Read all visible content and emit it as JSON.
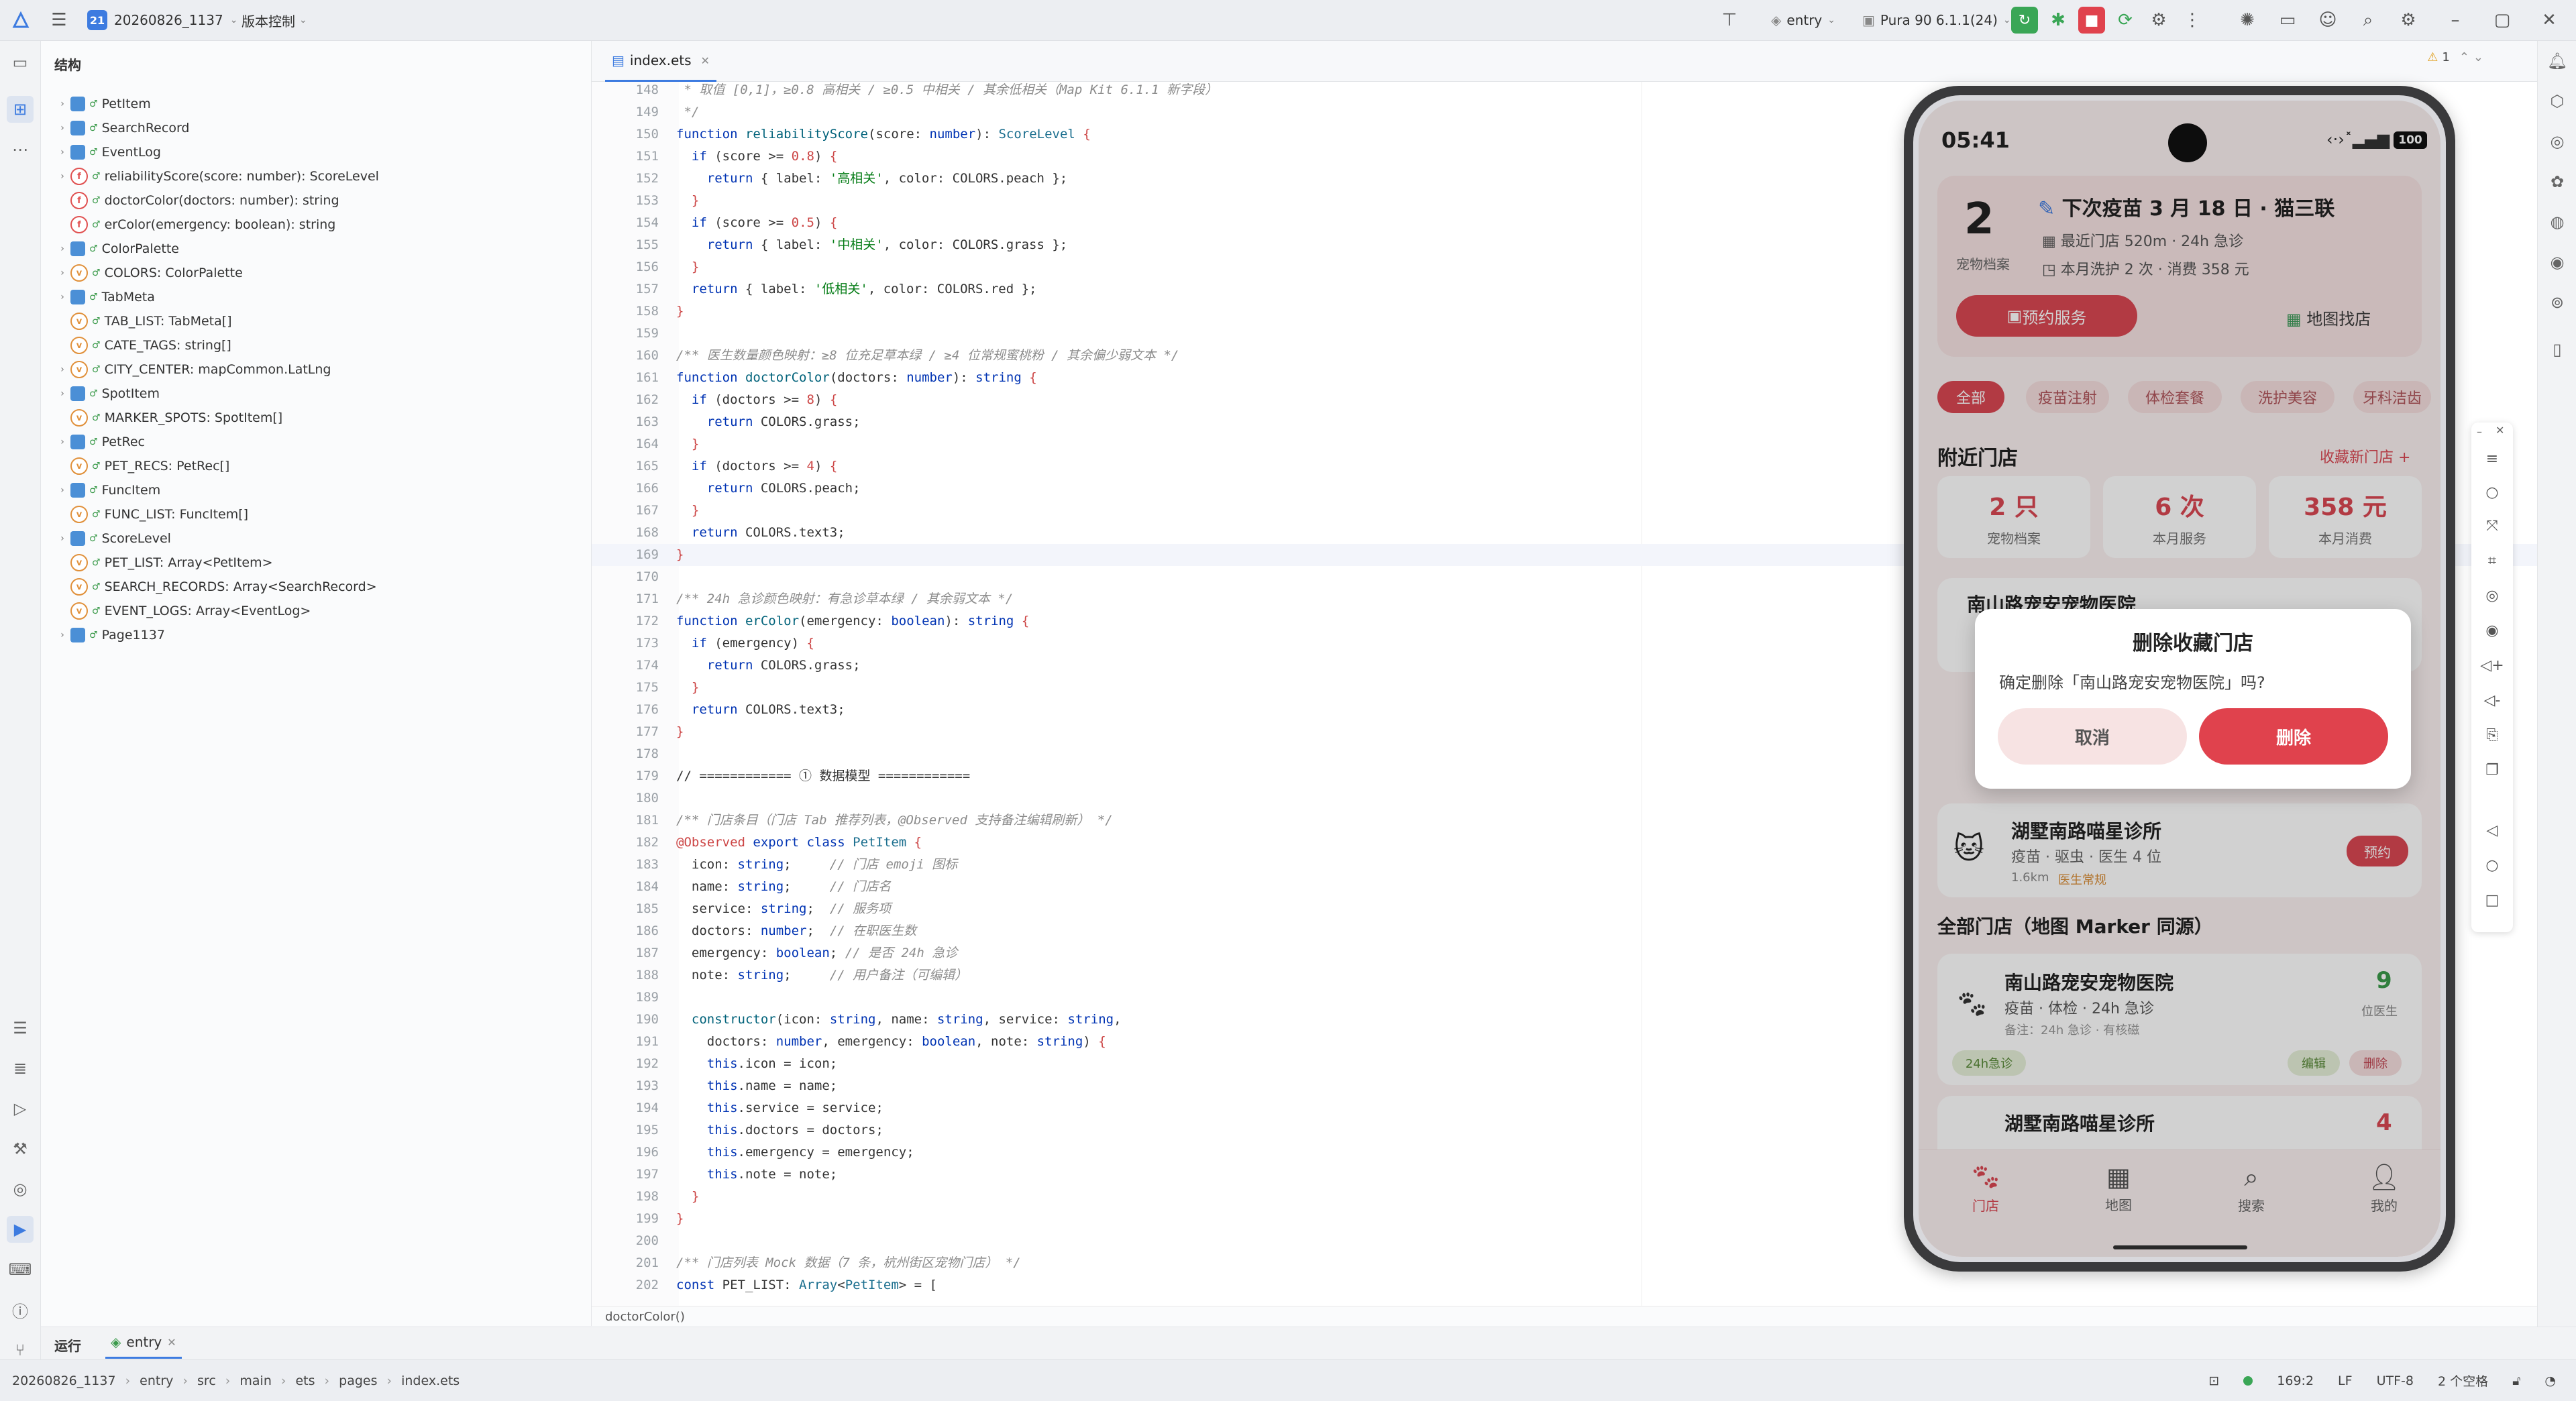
{
  "titlebar": {
    "project_number": "21",
    "project_name": "20260826_1137",
    "vcs_label": "版本控制",
    "run_config": "entry",
    "device": "Pura 90 6.1.1(24)"
  },
  "structure": {
    "title": "结构",
    "items": [
      {
        "label": "PetItem",
        "kind": "c",
        "expand": true
      },
      {
        "label": "SearchRecord",
        "kind": "c",
        "expand": true
      },
      {
        "label": "EventLog",
        "kind": "c",
        "expand": true
      },
      {
        "label": "reliabilityScore(score: number): ScoreLevel",
        "kind": "f",
        "expand": true
      },
      {
        "label": "doctorColor(doctors: number): string",
        "kind": "f",
        "expand": false
      },
      {
        "label": "erColor(emergency: boolean): string",
        "kind": "f",
        "expand": false
      },
      {
        "label": "ColorPalette",
        "kind": "c",
        "expand": true
      },
      {
        "label": "COLORS: ColorPalette",
        "kind": "v",
        "expand": true
      },
      {
        "label": "TabMeta",
        "kind": "c",
        "expand": true
      },
      {
        "label": "TAB_LIST: TabMeta[]",
        "kind": "v",
        "expand": false
      },
      {
        "label": "CATE_TAGS: string[]",
        "kind": "v",
        "expand": false
      },
      {
        "label": "CITY_CENTER: mapCommon.LatLng",
        "kind": "v",
        "expand": true
      },
      {
        "label": "SpotItem",
        "kind": "c",
        "expand": true
      },
      {
        "label": "MARKER_SPOTS: SpotItem[]",
        "kind": "v",
        "expand": false
      },
      {
        "label": "PetRec",
        "kind": "c",
        "expand": true
      },
      {
        "label": "PET_RECS: PetRec[]",
        "kind": "v",
        "expand": false
      },
      {
        "label": "FuncItem",
        "kind": "c",
        "expand": true
      },
      {
        "label": "FUNC_LIST: FuncItem[]",
        "kind": "v",
        "expand": false
      },
      {
        "label": "ScoreLevel",
        "kind": "c",
        "expand": true
      },
      {
        "label": "PET_LIST: Array<PetItem>",
        "kind": "v",
        "expand": false
      },
      {
        "label": "SEARCH_RECORDS: Array<SearchRecord>",
        "kind": "v",
        "expand": false
      },
      {
        "label": "EVENT_LOGS: Array<EventLog>",
        "kind": "v",
        "expand": false
      },
      {
        "label": "Page1137",
        "kind": "c",
        "expand": true
      }
    ]
  },
  "editor": {
    "tab_label": "index.ets",
    "warning_count": "1",
    "breadcrumb_fn": "doctorColor()",
    "current_line": 169,
    "lines": [
      {
        "n": "148",
        "html": "<span class='cm'> * 取值 [0,1]，≥0.8 高相关 / ≥0.5 中相关 / 其余低相关（Map Kit 6.1.1 新字段）</span>"
      },
      {
        "n": "149",
        "html": "<span class='cm'> */</span>"
      },
      {
        "n": "150",
        "html": "<span class='kw'>function</span> <span class='fn'>reliabilityScore</span>(score: <span class='kw'>number</span>): <span class='ty'>ScoreLevel</span> <span class='br'>{</span>"
      },
      {
        "n": "151",
        "html": "  <span class='kw'>if</span> (score &gt;= <span class='br'>0.8</span>) <span class='br'>{</span>"
      },
      {
        "n": "152",
        "html": "    <span class='kw'>return</span> { label: <span class='str'>'高相关'</span>, color: COLORS.peach };"
      },
      {
        "n": "153",
        "html": "  <span class='br'>}</span>"
      },
      {
        "n": "154",
        "html": "  <span class='kw'>if</span> (score &gt;= <span class='br'>0.5</span>) <span class='br'>{</span>"
      },
      {
        "n": "155",
        "html": "    <span class='kw'>return</span> { label: <span class='str'>'中相关'</span>, color: COLORS.grass };"
      },
      {
        "n": "156",
        "html": "  <span class='br'>}</span>"
      },
      {
        "n": "157",
        "html": "  <span class='kw'>return</span> { label: <span class='str'>'低相关'</span>, color: COLORS.red };"
      },
      {
        "n": "158",
        "html": "<span class='br'>}</span>"
      },
      {
        "n": "159",
        "html": ""
      },
      {
        "n": "160",
        "html": "<span class='cm'>/** 医生数量颜色映射：≥8 位充足草本绿 / ≥4 位常规蜜桃粉 / 其余偏少弱文本 */</span>"
      },
      {
        "n": "161",
        "html": "<span class='kw'>function</span> <span class='fn'>doctorColor</span>(doctors: <span class='kw'>number</span>): <span class='kw'>string</span> <span class='br'>{</span>"
      },
      {
        "n": "162",
        "html": "  <span class='kw'>if</span> (doctors &gt;= <span class='br'>8</span>) <span class='br'>{</span>"
      },
      {
        "n": "163",
        "html": "    <span class='kw'>return</span> COLORS.grass;"
      },
      {
        "n": "164",
        "html": "  <span class='br'>}</span>"
      },
      {
        "n": "165",
        "html": "  <span class='kw'>if</span> (doctors &gt;= <span class='br'>4</span>) <span class='br'>{</span>"
      },
      {
        "n": "166",
        "html": "    <span class='kw'>return</span> COLORS.peach;"
      },
      {
        "n": "167",
        "html": "  <span class='br'>}</span>"
      },
      {
        "n": "168",
        "html": "  <span class='kw'>return</span> COLORS.text3;"
      },
      {
        "n": "169",
        "html": "<span class='br'>}</span>"
      },
      {
        "n": "170",
        "html": ""
      },
      {
        "n": "171",
        "html": "<span class='cm'>/** 24h 急诊颜色映射：有急诊草本绿 / 其余弱文本 */</span>"
      },
      {
        "n": "172",
        "html": "<span class='kw'>function</span> <span class='fn'>erColor</span>(emergency: <span class='kw'>boolean</span>): <span class='kw'>string</span> <span class='br'>{</span>"
      },
      {
        "n": "173",
        "html": "  <span class='kw'>if</span> (emergency) <span class='br'>{</span>"
      },
      {
        "n": "174",
        "html": "    <span class='kw'>return</span> COLORS.grass;"
      },
      {
        "n": "175",
        "html": "  <span class='br'>}</span>"
      },
      {
        "n": "176",
        "html": "  <span class='kw'>return</span> COLORS.text3;"
      },
      {
        "n": "177",
        "html": "<span class='br'>}</span>"
      },
      {
        "n": "178",
        "html": ""
      },
      {
        "n": "179",
        "html": "// ============ ① 数据模型 ============"
      },
      {
        "n": "180",
        "html": ""
      },
      {
        "n": "181",
        "html": "<span class='cm'>/** 门店条目（门店 Tab 推荐列表，@Observed 支持备注编辑刷新） */</span>"
      },
      {
        "n": "182",
        "html": "<span class='br'>@Observed</span> <span class='kw'>export class</span> <span class='ty'>PetItem</span> <span class='br'>{</span>"
      },
      {
        "n": "183",
        "html": "  icon: <span class='kw'>string</span>;     <span class='cm'>// 门店 emoji 图标</span>"
      },
      {
        "n": "184",
        "html": "  name: <span class='kw'>string</span>;     <span class='cm'>// 门店名</span>"
      },
      {
        "n": "185",
        "html": "  service: <span class='kw'>string</span>;  <span class='cm'>// 服务项</span>"
      },
      {
        "n": "186",
        "html": "  doctors: <span class='kw'>number</span>;  <span class='cm'>// 在职医生数</span>"
      },
      {
        "n": "187",
        "html": "  emergency: <span class='kw'>boolean</span>; <span class='cm'>// 是否 24h 急诊</span>"
      },
      {
        "n": "188",
        "html": "  note: <span class='kw'>string</span>;     <span class='cm'>// 用户备注（可编辑）</span>"
      },
      {
        "n": "189",
        "html": ""
      },
      {
        "n": "190",
        "html": "  <span class='fn'>constructor</span>(icon: <span class='kw'>string</span>, name: <span class='kw'>string</span>, service: <span class='kw'>string</span>,"
      },
      {
        "n": "191",
        "html": "    doctors: <span class='kw'>number</span>, emergency: <span class='kw'>boolean</span>, note: <span class='kw'>string</span>) <span class='br'>{</span>"
      },
      {
        "n": "192",
        "html": "    <span class='kw'>this</span>.icon = icon;"
      },
      {
        "n": "193",
        "html": "    <span class='kw'>this</span>.name = name;"
      },
      {
        "n": "194",
        "html": "    <span class='kw'>this</span>.service = service;"
      },
      {
        "n": "195",
        "html": "    <span class='kw'>this</span>.doctors = doctors;"
      },
      {
        "n": "196",
        "html": "    <span class='kw'>this</span>.emergency = emergency;"
      },
      {
        "n": "197",
        "html": "    <span class='kw'>this</span>.note = note;"
      },
      {
        "n": "198",
        "html": "  <span class='br'>}</span>"
      },
      {
        "n": "199",
        "html": "<span class='br'>}</span>"
      },
      {
        "n": "200",
        "html": ""
      },
      {
        "n": "201",
        "html": "<span class='cm'>/** 门店列表 Mock 数据（7 条，杭州街区宠物门店） */</span>"
      },
      {
        "n": "202",
        "html": "<span class='kw'>const</span> PET_LIST: <span class='ty'>Array</span>&lt;<span class='ty'>PetItem</span>&gt; = ["
      }
    ]
  },
  "run_panel": {
    "run_label": "运行",
    "tab_label": "entry"
  },
  "statusbar": {
    "path": [
      "20260826_1137",
      "entry",
      "src",
      "main",
      "ets",
      "pages",
      "index.ets"
    ],
    "position": "169:2",
    "line_sep": "LF",
    "encoding": "UTF-8",
    "indent": "2 个空格"
  },
  "phone": {
    "time": "05:41",
    "battery": "100",
    "header": {
      "pet_count": "2",
      "pet_label": "宠物档案",
      "line1": "下次疫苗 3 月 18 日 · 猫三联",
      "line2": "最近门店 520m · 24h 急诊",
      "line3": "本月洗护 2 次 · 消费 358 元",
      "book_btn": "预约服务",
      "map_btn": "地图找店"
    },
    "chips": [
      "全部",
      "疫苗注射",
      "体检套餐",
      "洗护美容",
      "牙科洁齿"
    ],
    "nearby_title": "附近门店",
    "fav_link": "收藏新门店 +",
    "stats": [
      {
        "value": "2 只",
        "label": "宠物档案"
      },
      {
        "value": "6 次",
        "label": "本月服务"
      },
      {
        "value": "358 元",
        "label": "本月消费"
      }
    ],
    "card1_name": "南山路宠安宠物医院",
    "card2": {
      "name": "湖墅南路喵星诊所",
      "desc": "疫苗 · 驱虫 · 医生 4 位",
      "dist": "1.6km",
      "tag": "医生常规",
      "btn": "预约"
    },
    "all_title": "全部门店（地图 Marker 同源）",
    "store1": {
      "name": "南山路宠安宠物医院",
      "desc": "疫苗 · 体检 · 24h 急诊",
      "note": "备注：24h 急诊 · 有核磁",
      "count": "9",
      "count_label": "位医生",
      "badge": "24h急诊",
      "edit": "编辑",
      "del": "删除"
    },
    "store2": {
      "name": "湖墅南路喵星诊所",
      "count": "4"
    },
    "nav": [
      "门店",
      "地图",
      "搜索",
      "我的"
    ],
    "dialog": {
      "title": "删除收藏门店",
      "message": "确定删除「南山路宠安宠物医院」吗?",
      "cancel": "取消",
      "confirm": "删除"
    }
  },
  "colors": {
    "accent": "#e0424d",
    "ide_blue": "#3d7be0",
    "screen_bg": "#fbf1f1"
  }
}
